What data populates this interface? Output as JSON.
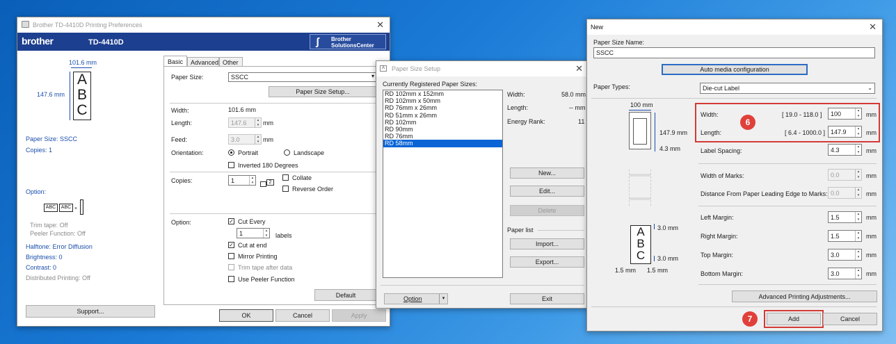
{
  "pref": {
    "title": "Brother TD-4410D Printing Preferences",
    "logo": "brother",
    "model": "TD-4410D",
    "solutions": [
      "Brother",
      "SolutionsCenter"
    ],
    "preview": {
      "width_label": "101.6 mm",
      "length_label": "147.6 mm",
      "glyphs": [
        "A",
        "B",
        "C"
      ]
    },
    "info": {
      "paper_size": "Paper Size: SSCC",
      "copies": "Copies: 1",
      "option": "Option:",
      "abc1": "ABC",
      "abc2": "ABC",
      "trim": "Trim tape: Off",
      "peeler": "Peeler Function: Off",
      "halftone": "Halftone: Error Diffusion",
      "brightness": "Brightness:   0",
      "contrast": "Contrast:   0",
      "distributed": "Distributed Printing: Off"
    },
    "support_button": "Support...",
    "tabs": [
      "Basic",
      "Advanced",
      "Other"
    ],
    "form": {
      "paper_size_label": "Paper Size:",
      "paper_size_value": "SSCC",
      "paper_size_setup_button": "Paper Size Setup...",
      "width_label": "Width:",
      "width_value": "101.6 mm",
      "length_label": "Length:",
      "length_value": "147.6",
      "length_unit": "mm",
      "feed_label": "Feed:",
      "feed_value": "3.0",
      "feed_unit": "mm",
      "orientation_label": "Orientation:",
      "portrait": "Portrait",
      "landscape": "Landscape",
      "inverted": "Inverted 180 Degrees",
      "copies_label": "Copies:",
      "copies_value": "1",
      "collate": "Collate",
      "reverse": "Reverse Order",
      "option_label": "Option:",
      "cut_every": "Cut Every",
      "cut_every_value": "1",
      "labels": "labels",
      "cut_at_end": "Cut at end",
      "mirror": "Mirror Printing",
      "trim_after": "Trim tape after data",
      "peeler": "Use Peeler Function"
    },
    "default_button": "Default",
    "ok_button": "OK",
    "cancel_button": "Cancel",
    "apply_button": "Apply"
  },
  "setup": {
    "title": "Paper Size Setup",
    "list_label": "Currently Registered Paper Sizes:",
    "items": [
      "RD 102mm x 152mm",
      "RD 102mm x 50mm",
      "RD 76mm x 26mm",
      "RD 51mm x 26mm",
      "RD 102mm",
      "RD 90mm",
      "RD 76mm",
      "RD 58mm"
    ],
    "selected_index": 7,
    "width_label": "Width:",
    "width_value": "58.0 mm",
    "length_label": "Length:",
    "length_value": "-- mm",
    "energy_label": "Energy Rank:",
    "energy_value": "11",
    "new_button": "New...",
    "edit_button": "Edit...",
    "delete_button": "Delete",
    "paper_list_label": "Paper list",
    "import_button": "Import...",
    "export_button": "Export...",
    "option_button": "Option",
    "exit_button": "Exit"
  },
  "newdlg": {
    "title": "New",
    "name_label": "Paper Size Name:",
    "name_value": "SSCC",
    "auto_button": "Auto media configuration",
    "types_label": "Paper Types:",
    "types_value": "Die-cut Label",
    "diagram": {
      "w": "100 mm",
      "h": "147.9 mm",
      "gap": "4.3 mm",
      "m1": "3.0 mm",
      "m2": "3.0 mm",
      "m3": "1.5 mm",
      "m4": "1.5 mm",
      "glyphs": [
        "A",
        "B",
        "C"
      ]
    },
    "width_label": "Width:",
    "width_range": "[ 19.0 - 118.0 ]",
    "width_value": "100",
    "length_label": "Length:",
    "length_range": "[ 6.4 - 1000.0 ]",
    "length_value": "147.9",
    "spacing_label": "Label Spacing:",
    "spacing_value": "4.3",
    "marks_label": "Width of Marks:",
    "marks_value": "0.0",
    "distance_label": "Distance From Paper Leading Edge to Marks:",
    "distance_value": "0.0",
    "left_label": "Left Margin:",
    "left_value": "1.5",
    "right_label": "Right Margin:",
    "right_value": "1.5",
    "top_label": "Top Margin:",
    "top_value": "3.0",
    "bottom_label": "Bottom Margin:",
    "bottom_value": "3.0",
    "unit": "mm",
    "advanced_button": "Advanced Printing Adjustments...",
    "add_button": "Add",
    "cancel_button": "Cancel",
    "badge6": "6",
    "badge7": "7"
  },
  "colors": {
    "accent": "#1a4dab",
    "brand_bar": "#1d3f8f",
    "highlight": "#e0403a",
    "selection": "#0a64d6"
  }
}
